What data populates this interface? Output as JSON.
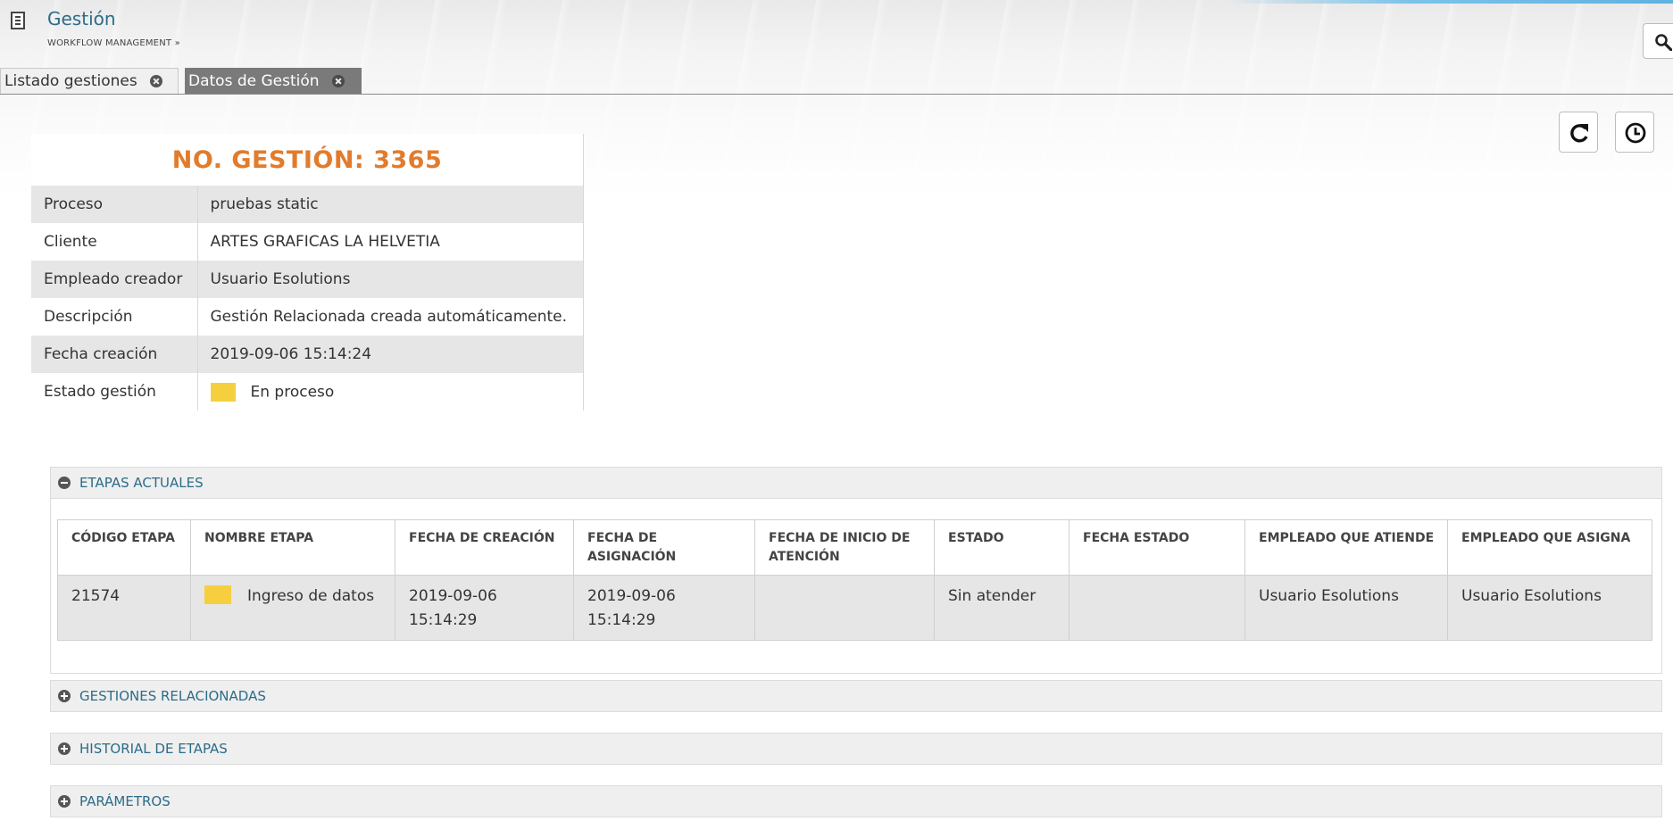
{
  "app": {
    "title": "Gestión",
    "breadcrumb": "WORKFLOW MANAGEMENT »"
  },
  "tabs": [
    {
      "label": "Listado gestiones",
      "active": false
    },
    {
      "label": "Datos de Gestión",
      "active": true
    }
  ],
  "record": {
    "title": "NO. GESTIÓN: 3365",
    "fields": [
      {
        "label": "Proceso",
        "value": "pruebas static"
      },
      {
        "label": "Cliente",
        "value": "ARTES GRAFICAS LA HELVETIA"
      },
      {
        "label": "Empleado creador",
        "value": "Usuario Esolutions"
      },
      {
        "label": "Descripción",
        "value": "Gestión Relacionada creada automáticamente."
      },
      {
        "label": "Fecha creación",
        "value": "2019-09-06 15:14:24"
      },
      {
        "label": "Estado gestión",
        "value": "En proceso",
        "status_color": "#f6cf3f"
      }
    ]
  },
  "sections": {
    "current_stages": {
      "title": "ETAPAS ACTUALES",
      "expanded": true,
      "columns": [
        "CÓDIGO ETAPA",
        "NOMBRE ETAPA",
        "FECHA DE CREACIÓN",
        "FECHA DE ASIGNACIÓN",
        "FECHA DE INICIO DE ATENCIÓN",
        "ESTADO",
        "FECHA ESTADO",
        "EMPLEADO QUE ATIENDE",
        "EMPLEADO QUE ASIGNA"
      ],
      "rows": [
        {
          "codigo": "21574",
          "nombre": "Ingreso de datos",
          "status_color": "#f6cf3f",
          "fecha_creacion": "2019-09-06 15:14:29",
          "fecha_asignacion": "2019-09-06 15:14:29",
          "fecha_inicio": "",
          "estado": "Sin atender",
          "fecha_estado": "",
          "empleado_atiende": "Usuario Esolutions",
          "empleado_asigna": "Usuario Esolutions"
        }
      ]
    },
    "related": {
      "title": "GESTIONES RELACIONADAS",
      "expanded": false
    },
    "history": {
      "title": "HISTORIAL DE ETAPAS",
      "expanded": false
    },
    "params": {
      "title": "PARÁMETROS",
      "expanded": false
    }
  },
  "colors": {
    "accent_blue": "#2c6c88",
    "title_orange": "#e27b2b",
    "status_yellow": "#f6cf3f"
  },
  "icons": {
    "search": "search-icon",
    "refresh": "refresh-icon",
    "history": "clock-icon"
  }
}
